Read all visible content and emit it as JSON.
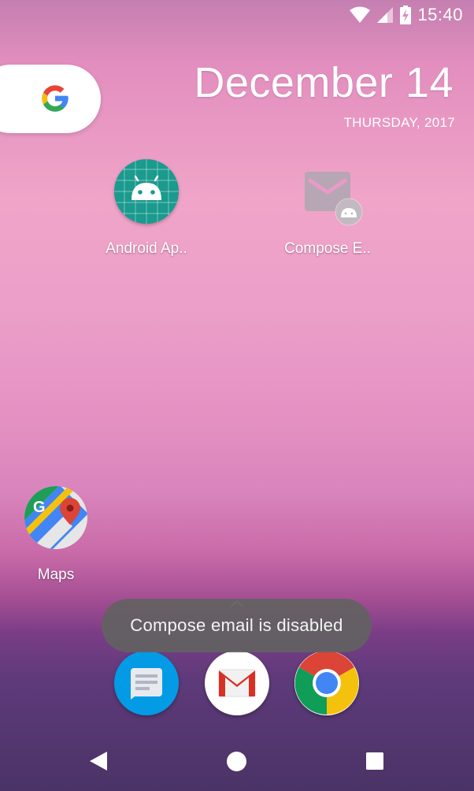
{
  "status_bar": {
    "time": "15:40",
    "icons": [
      "wifi-icon",
      "cell-signal-icon",
      "battery-charging-icon"
    ]
  },
  "search_widget": {
    "icon": "google-g-icon"
  },
  "date_widget": {
    "date": "December 14",
    "weekday_year": "THURSDAY, 2017"
  },
  "apps": [
    {
      "label": "Android Ap..",
      "icon": "android-app-icon"
    },
    {
      "label": "Compose E..",
      "icon": "compose-email-icon"
    },
    {
      "label": "Maps",
      "icon": "maps-icon"
    }
  ],
  "dock": [
    {
      "icon": "messages-icon"
    },
    {
      "icon": "gmail-icon"
    },
    {
      "icon": "chrome-icon"
    }
  ],
  "toast": {
    "message": "Compose email is disabled"
  },
  "nav_bar": {
    "buttons": [
      "back-icon",
      "home-icon",
      "recents-icon"
    ]
  },
  "colors": {
    "android_teal": "#1b9a8e",
    "toast_bg": "#626262",
    "messages_blue": "#039be5",
    "gmail_red": "#d93025"
  }
}
